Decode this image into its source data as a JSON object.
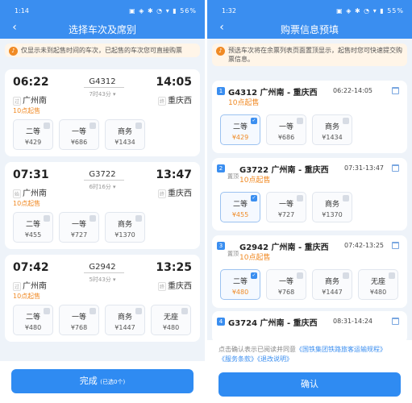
{
  "left": {
    "status_time": "1:14",
    "status_icons": "▣ ◈ ✱ ◔ ▾ ▮ 56%",
    "title": "选择车次及席别",
    "notice": "仅显示未到起售时间的车次，已起售的车次您可直接购票",
    "trains": [
      {
        "dep": "06:22",
        "arr": "14:05",
        "num": "G4312",
        "dur": "7时43分 ▾",
        "from": "广州南",
        "to": "重庆西",
        "from_tag": "过",
        "to_tag": "终",
        "sale": "10点起售",
        "seats": [
          {
            "name": "二等",
            "price": "¥429"
          },
          {
            "name": "一等",
            "price": "¥686"
          },
          {
            "name": "商务",
            "price": "¥1434"
          }
        ]
      },
      {
        "dep": "07:31",
        "arr": "13:47",
        "num": "G3722",
        "dur": "6时16分 ▾",
        "from": "广州南",
        "to": "重庆西",
        "from_tag": "始",
        "to_tag": "终",
        "sale": "10点起售",
        "seats": [
          {
            "name": "二等",
            "price": "¥455"
          },
          {
            "name": "一等",
            "price": "¥727"
          },
          {
            "name": "商务",
            "price": "¥1370"
          }
        ]
      },
      {
        "dep": "07:42",
        "arr": "13:25",
        "num": "G2942",
        "dur": "5时43分 ▾",
        "from": "广州南",
        "to": "重庆西",
        "from_tag": "过",
        "to_tag": "终",
        "sale": "10点起售",
        "seats": [
          {
            "name": "二等",
            "price": "¥480"
          },
          {
            "name": "一等",
            "price": "¥768"
          },
          {
            "name": "商务",
            "price": "¥1447"
          },
          {
            "name": "无座",
            "price": "¥480"
          }
        ]
      }
    ],
    "done_label": "完成",
    "done_sub": "(已选0个)"
  },
  "right": {
    "status_time": "1:32",
    "status_icons": "▣ ◈ ✱ ◔ ▾ ▮ 55%",
    "title": "购票信息预填",
    "notice": "预选车次将在余票列表页面置顶显示，起售时您可快速提交购票信息。",
    "bookings": [
      {
        "idx": "1",
        "train": "G4312  广州南 - 重庆西",
        "time": "06:22-14:05",
        "sale": "10点起售",
        "pin": "",
        "seats": [
          {
            "name": "二等",
            "price": "¥429",
            "sel": true
          },
          {
            "name": "一等",
            "price": "¥686"
          },
          {
            "name": "商务",
            "price": "¥1434"
          }
        ]
      },
      {
        "idx": "2",
        "train": "G3722  广州南 - 重庆西",
        "time": "07:31-13:47",
        "sale": "10点起售",
        "pin": "置顶",
        "seats": [
          {
            "name": "二等",
            "price": "¥455",
            "sel": true
          },
          {
            "name": "一等",
            "price": "¥727"
          },
          {
            "name": "商务",
            "price": "¥1370"
          }
        ]
      },
      {
        "idx": "3",
        "train": "G2942  广州南 - 重庆西",
        "time": "07:42-13:25",
        "sale": "10点起售",
        "pin": "置顶",
        "seats": [
          {
            "name": "二等",
            "price": "¥480",
            "sel": true
          },
          {
            "name": "一等",
            "price": "¥768"
          },
          {
            "name": "商务",
            "price": "¥1447"
          },
          {
            "name": "无座",
            "price": "¥480"
          }
        ]
      },
      {
        "idx": "4",
        "train": "G3724  广州南 - 重庆西",
        "time": "08:31-14:24",
        "sale": "",
        "pin": "",
        "seats": []
      }
    ],
    "agree_text": "点击确认表示已阅读并同意",
    "agree_link1": "《国铁集团铁路旅客运输规程》",
    "agree_link2": "《服务条款》",
    "agree_link3": "《退改说明》",
    "confirm_label": "确认"
  },
  "colors": {
    "header": "#3a8ef0",
    "accent_orange": "#f08a24",
    "button": "#2f8bf2"
  }
}
